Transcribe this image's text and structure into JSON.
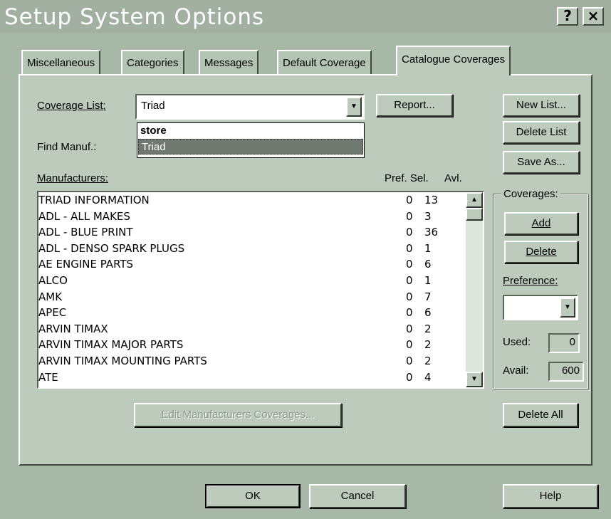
{
  "window": {
    "title": "Setup System Options",
    "help_button": "?",
    "close_button": "×"
  },
  "tabs": [
    {
      "label": "Miscellaneous"
    },
    {
      "label": "Categories"
    },
    {
      "label": "Messages"
    },
    {
      "label": "Default Coverage"
    },
    {
      "label": "Catalogue Coverages",
      "active": true
    }
  ],
  "coverage_list": {
    "label": "Coverage List:",
    "value": "Triad",
    "options": [
      "store",
      "Triad"
    ],
    "selected": "Triad"
  },
  "report_button": "Report...",
  "find_manuf": {
    "label": "Find Manuf.:"
  },
  "manufacturers": {
    "label": "Manufacturers:",
    "col_pref_sel": "Pref. Sel.",
    "col_avl": "Avl.",
    "rows": [
      {
        "name": "TRIAD INFORMATION",
        "pref": "0",
        "avl": "13"
      },
      {
        "name": "ADL - ALL MAKES",
        "pref": "0",
        "avl": "3"
      },
      {
        "name": "ADL - BLUE PRINT",
        "pref": "0",
        "avl": "36"
      },
      {
        "name": "ADL - DENSO SPARK PLUGS",
        "pref": "0",
        "avl": "1"
      },
      {
        "name": "AE ENGINE PARTS",
        "pref": "0",
        "avl": "6"
      },
      {
        "name": "ALCO",
        "pref": "0",
        "avl": "1"
      },
      {
        "name": "AMK",
        "pref": "0",
        "avl": "7"
      },
      {
        "name": "APEC",
        "pref": "0",
        "avl": "6"
      },
      {
        "name": "ARVIN TIMAX",
        "pref": "0",
        "avl": "2"
      },
      {
        "name": "ARVIN TIMAX MAJOR PARTS",
        "pref": "0",
        "avl": "2"
      },
      {
        "name": "ARVIN TIMAX MOUNTING PARTS",
        "pref": "0",
        "avl": "2"
      },
      {
        "name": "ATE",
        "pref": "0",
        "avl": "4"
      }
    ]
  },
  "right_buttons": {
    "new_list": "New List...",
    "delete_list": "Delete List",
    "save_as": "Save As..."
  },
  "coverages": {
    "title": "Coverages:",
    "add": "Add",
    "delete": "Delete",
    "preference_label": "Preference:",
    "preference_value": "",
    "used_label": "Used:",
    "used_value": "0",
    "avail_label": "Avail:",
    "avail_value": "600"
  },
  "edit_button": "Edit Manufacturers Coverages...",
  "delete_all_button": "Delete All",
  "footer": {
    "ok": "OK",
    "cancel": "Cancel",
    "help": "Help"
  }
}
